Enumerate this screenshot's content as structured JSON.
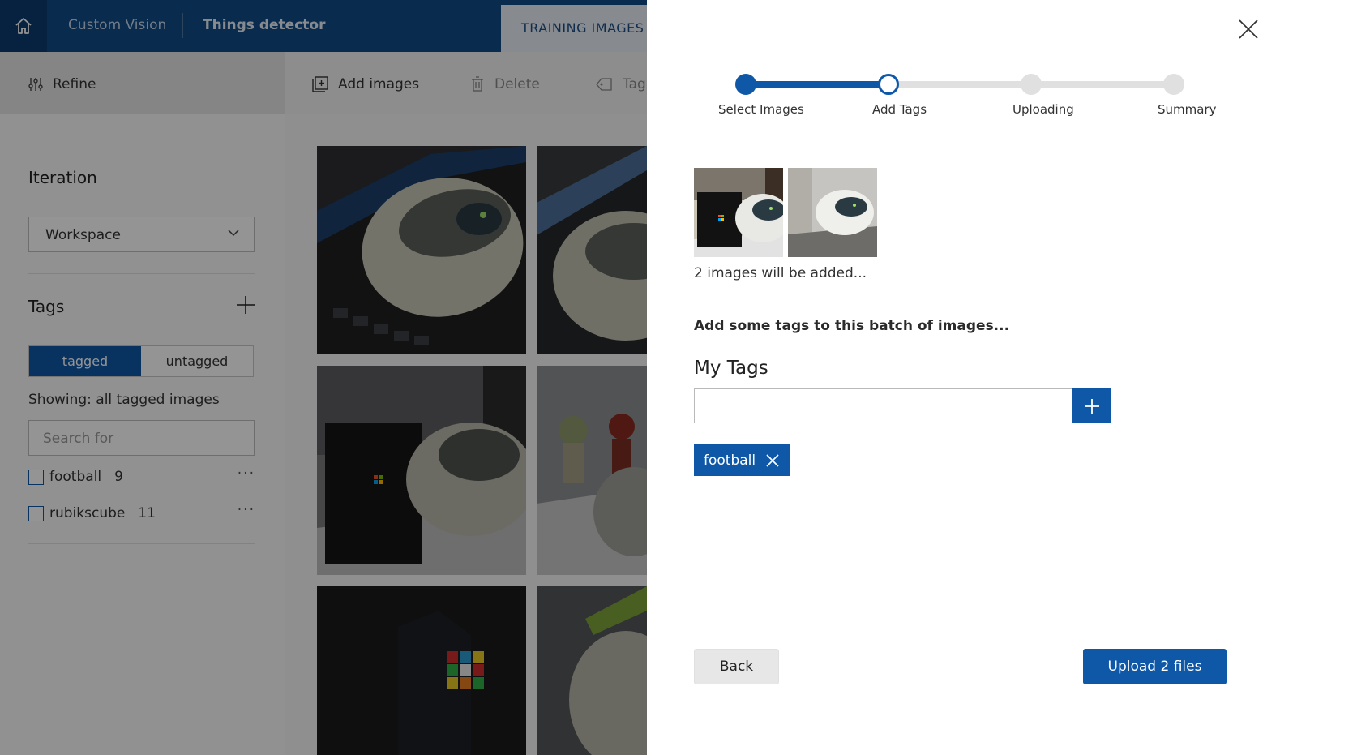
{
  "header": {
    "brand": "Custom Vision",
    "project": "Things detector",
    "tab_training": "TRAINING IMAGES"
  },
  "toolbar": {
    "refine": "Refine",
    "add_images": "Add images",
    "delete": "Delete",
    "tag": "Tag"
  },
  "sidebar": {
    "iteration_heading": "Iteration",
    "iteration_value": "Workspace",
    "tags_heading": "Tags",
    "toggle": {
      "tagged": "tagged",
      "untagged": "untagged",
      "active": "tagged"
    },
    "showing": "Showing: all tagged images",
    "search_placeholder": "Search for",
    "tags": [
      {
        "name": "football",
        "count": "9"
      },
      {
        "name": "rubikscube",
        "count": "11"
      }
    ],
    "more": "···"
  },
  "dialog": {
    "steps": [
      {
        "label": "Select Images",
        "state": "complete"
      },
      {
        "label": "Add Tags",
        "state": "current"
      },
      {
        "label": "Uploading",
        "state": "pending"
      },
      {
        "label": "Summary",
        "state": "pending"
      }
    ],
    "preview_caption": "2 images will be added...",
    "instructions": "Add some tags to this batch of images...",
    "my_tags_heading": "My Tags",
    "tag_input_value": "",
    "selected_tags": [
      "football"
    ],
    "back_label": "Back",
    "upload_label": "Upload 2 files"
  },
  "colors": {
    "primary": "#0f58a8",
    "topbar": "#0f4a87",
    "step_pending": "#e0e0e0"
  }
}
